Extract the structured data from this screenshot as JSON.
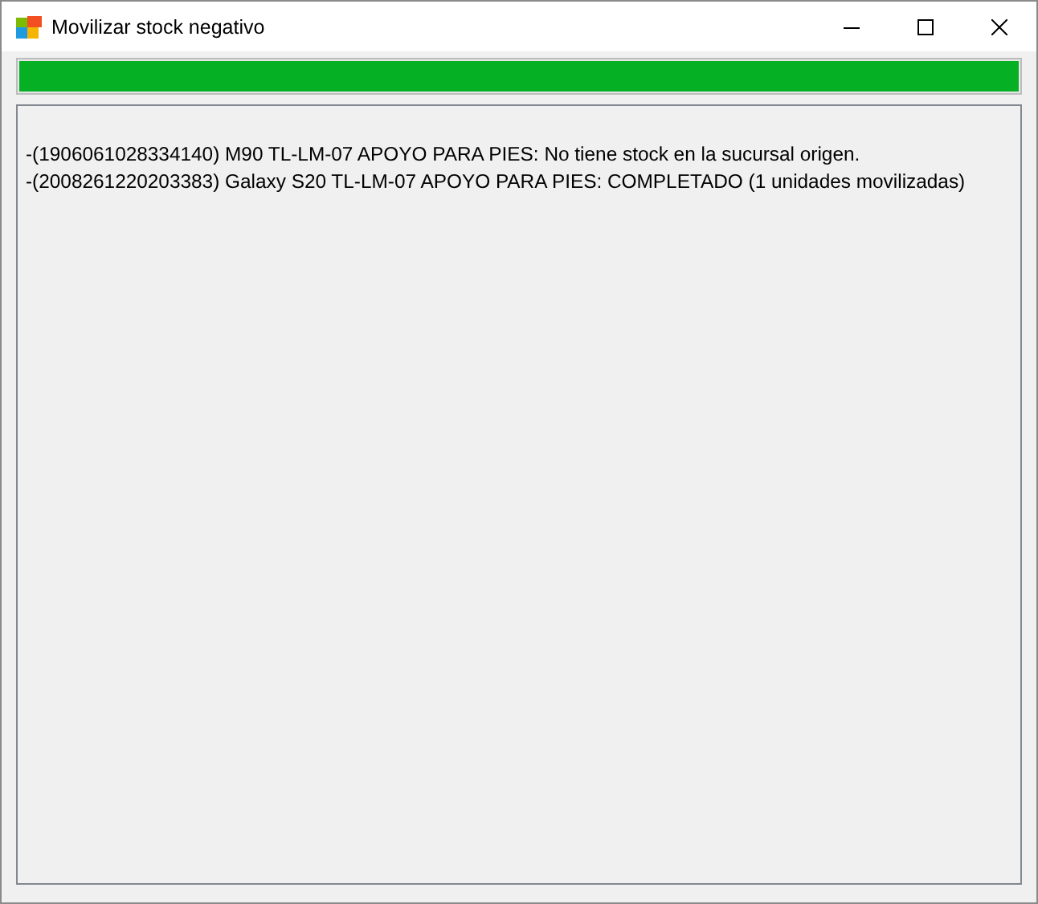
{
  "window": {
    "title": "Movilizar stock negativo"
  },
  "progress": {
    "level": 1
  },
  "log": {
    "lines": [
      "-(1906061028334140) M90 TL-LM-07 APOYO PARA PIES: No tiene stock en la sucursal origen.",
      "-(2008261220203383) Galaxy S20 TL-LM-07 APOYO PARA PIES: COMPLETADO (1 unidades movilizadas)"
    ]
  }
}
